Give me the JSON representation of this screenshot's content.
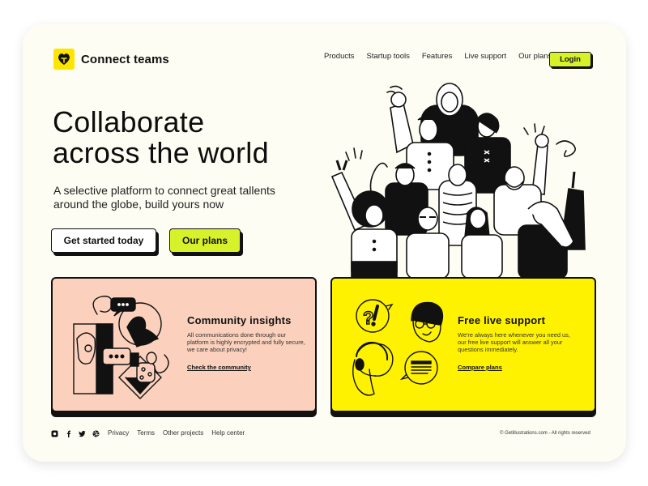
{
  "brand": {
    "name": "Connect teams",
    "logo_icon": "heart-sprout-icon",
    "logo_color": "#fde500"
  },
  "nav": {
    "items": [
      "Products",
      "Startup tools",
      "Features",
      "Live support",
      "Our plans"
    ],
    "login_label": "Login"
  },
  "hero": {
    "title_line1": "Collaborate",
    "title_line2": "across the world",
    "subtitle": "A selective platform to connect great tallents around the globe, build yours now",
    "primary_button": "Get started today",
    "secondary_button": "Our plans",
    "illustration": "group-of-diverse-people-waving"
  },
  "cards": [
    {
      "title": "Community insights",
      "description": "All communications done through our platform is highly encrypted and fully secure, we care about privacy!",
      "link": "Check the community",
      "illustration": "people-chatting-in-bubbles",
      "bg_color": "#fbd0bc"
    },
    {
      "title": "Free live support",
      "description": "We're always here whenever you need us, our free live support will answer all your questions immediately.",
      "link": "Compare plans",
      "illustration": "support-agent-with-headset",
      "bg_color": "#fff200"
    }
  ],
  "footer": {
    "social_icons": [
      "instagram-icon",
      "facebook-icon",
      "twitter-icon",
      "dribbble-icon"
    ],
    "links": [
      "Privacy",
      "Terms",
      "Other projects",
      "Help center"
    ],
    "copyright": "© Getillustrations.com - All rights reserved"
  },
  "colors": {
    "accent_lime": "#d7f22a",
    "page_bg": "#fdfdf3",
    "ink": "#111111"
  }
}
